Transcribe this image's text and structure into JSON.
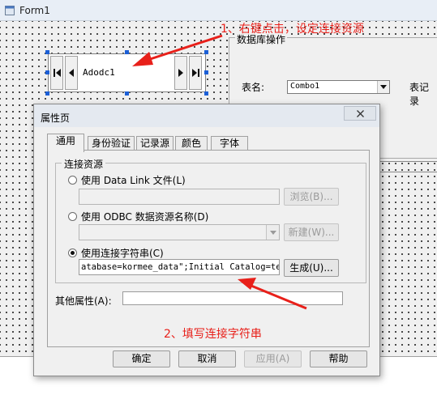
{
  "form": {
    "title": "Form1",
    "adodc_caption": "Adodc1",
    "group_title": "数据库操作",
    "table_label": "表名:",
    "combo_value": "Combo1",
    "right_label": "表记录"
  },
  "dialog": {
    "title": "属性页",
    "tabs": [
      "通用",
      "身份验证",
      "记录源",
      "颜色",
      "字体"
    ],
    "group_label": "连接资源",
    "option_datalink": "使用 Data Link 文件(L)",
    "option_odbc": "使用 ODBC 数据资源名称(D)",
    "option_connstr": "使用连接字符串(C)",
    "browse_button": "浏览(B)...",
    "new_button": "新建(W)...",
    "build_button": "生成(U)...",
    "connection_string": "atabase=kormee_data\";Initial Catalog=test",
    "other_props_label": "其他属性(A):",
    "other_props_value": "",
    "buttons": {
      "ok": "确定",
      "cancel": "取消",
      "apply": "应用(A)",
      "help": "帮助"
    },
    "selected_option": "connstr"
  },
  "annotations": {
    "note1": "1、右键点击，设定连接资源",
    "note2": "2、填写连接字符串"
  },
  "colors": {
    "annotation": "#e8201a",
    "handle": "#1c5fd6"
  }
}
